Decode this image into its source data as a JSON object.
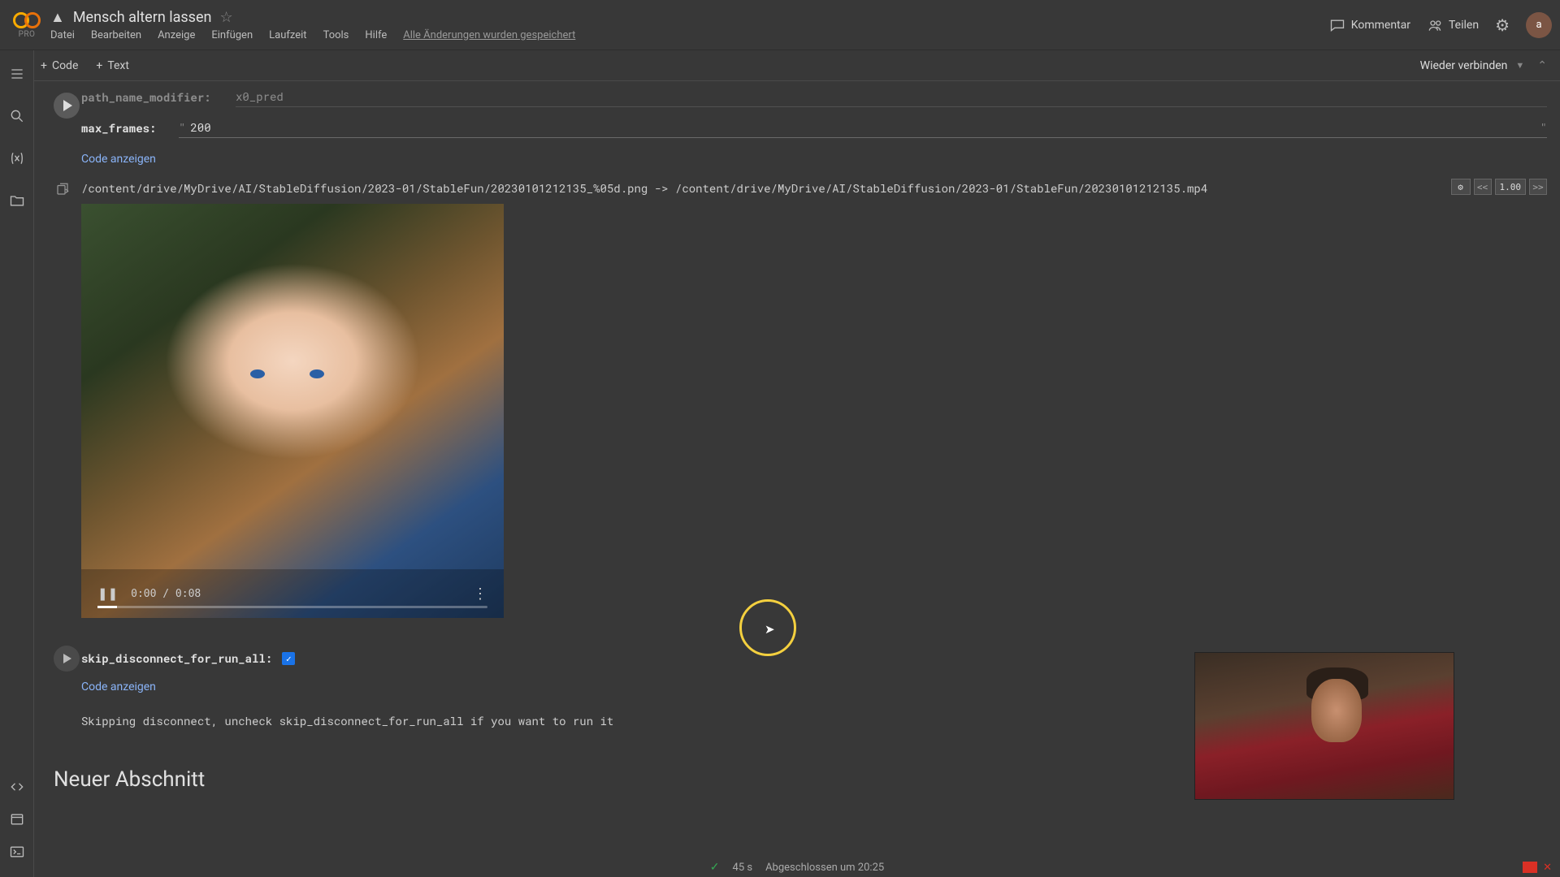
{
  "header": {
    "pro": "PRO",
    "title": "Mensch altern lassen",
    "menu": {
      "file": "Datei",
      "edit": "Bearbeiten",
      "view": "Anzeige",
      "insert": "Einfügen",
      "runtime": "Laufzeit",
      "tools": "Tools",
      "help": "Hilfe"
    },
    "autosave": "Alle Änderungen wurden gespeichert",
    "comment": "Kommentar",
    "share": "Teilen",
    "avatar": "a"
  },
  "toolbar": {
    "code": "Code",
    "text": "Text",
    "reconnect": "Wieder verbinden"
  },
  "cell1": {
    "path_label": "path_name_modifier:",
    "path_value": "x0_pred",
    "max_label": "max_frames:",
    "max_value": "200",
    "show_code": "Code anzeigen"
  },
  "output": {
    "path": "/content/drive/MyDrive/AI/StableDiffusion/2023-01/StableFun/20230101212135_%05d.png -> /content/drive/MyDrive/AI/StableDiffusion/2023-01/StableFun/20230101212135.mp4",
    "badges": {
      "zoom": "1.00",
      "prev": "<<",
      "next": ">>"
    },
    "video": {
      "time": "0:00 / 0:08"
    }
  },
  "cell2": {
    "skip_label": "skip_disconnect_for_run_all:",
    "show_code": "Code anzeigen",
    "skip_output": "Skipping disconnect, uncheck skip_disconnect_for_run_all if you want to run it"
  },
  "section": {
    "heading": "Neuer Abschnitt"
  },
  "status": {
    "duration": "45 s",
    "completed": "Abgeschlossen um 20:25"
  }
}
